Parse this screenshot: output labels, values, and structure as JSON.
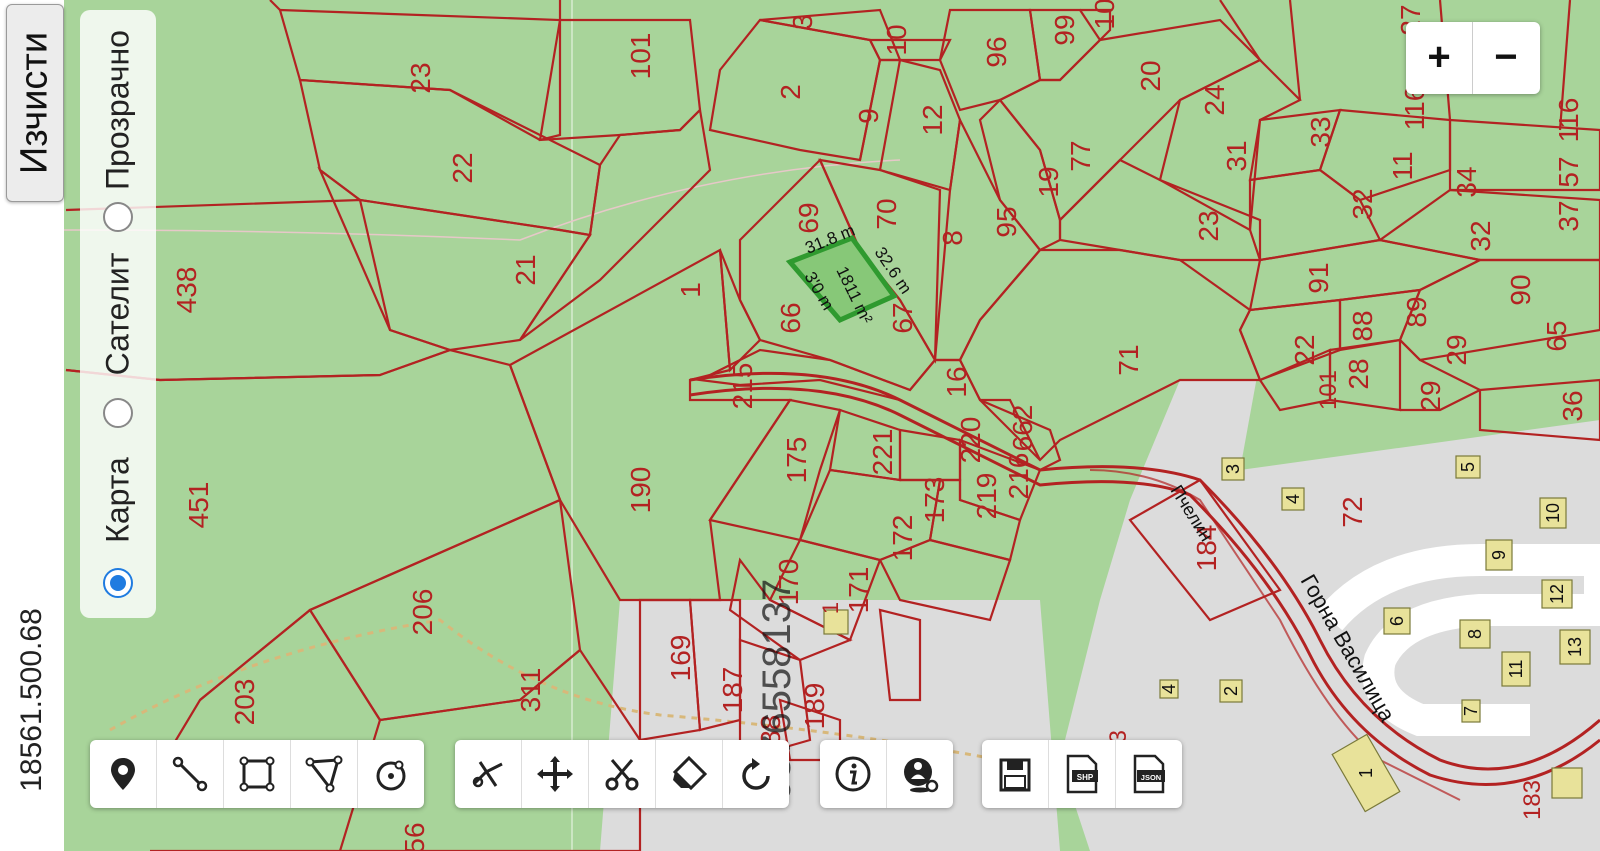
{
  "map": {
    "colors": {
      "forest": "#a8d49a",
      "urban": "#dcdcdc",
      "parcel_line": "#b32222",
      "selected": "#2f9a2f"
    },
    "parcels_left": [
      {
        "id": "p-23",
        "label": "23"
      },
      {
        "id": "p-22",
        "label": "22"
      },
      {
        "id": "p-21",
        "label": "21"
      },
      {
        "id": "p-438",
        "label": "438"
      },
      {
        "id": "p-451",
        "label": "451"
      },
      {
        "id": "p-206",
        "label": "206"
      },
      {
        "id": "p-203",
        "label": "203"
      },
      {
        "id": "p-311",
        "label": "311"
      },
      {
        "id": "p-101",
        "label": "101"
      },
      {
        "id": "p-190",
        "label": "190"
      },
      {
        "id": "p-1",
        "label": "1"
      },
      {
        "id": "p-56",
        "label": "56"
      }
    ],
    "parcels_center": [
      {
        "id": "p-2",
        "label": "2"
      },
      {
        "id": "p-3",
        "label": "3"
      },
      {
        "id": "p-10",
        "label": "10"
      },
      {
        "id": "p-9",
        "label": "9"
      },
      {
        "id": "p-12",
        "label": "12"
      },
      {
        "id": "p-69",
        "label": "69"
      },
      {
        "id": "p-70",
        "label": "70"
      },
      {
        "id": "p-8",
        "label": "8"
      },
      {
        "id": "p-66",
        "label": "66"
      },
      {
        "id": "p-67",
        "label": "67"
      },
      {
        "id": "p-215",
        "label": "215"
      },
      {
        "id": "p-16",
        "label": "16"
      },
      {
        "id": "p-175",
        "label": "175"
      },
      {
        "id": "p-221",
        "label": "221"
      },
      {
        "id": "p-220",
        "label": "220"
      },
      {
        "id": "p-173",
        "label": "173"
      },
      {
        "id": "p-219",
        "label": "219"
      },
      {
        "id": "p-172",
        "label": "172"
      },
      {
        "id": "p-171",
        "label": "171"
      },
      {
        "id": "p-170",
        "label": "170"
      },
      {
        "id": "p-169",
        "label": "169"
      },
      {
        "id": "p-187",
        "label": "187"
      },
      {
        "id": "p-188",
        "label": "188"
      },
      {
        "id": "p-189",
        "label": "189"
      },
      {
        "id": "p-662",
        "label": "662"
      },
      {
        "id": "p-216",
        "label": "216"
      },
      {
        "id": "p-1b",
        "label": "1"
      }
    ],
    "parcels_right": [
      {
        "id": "p-96",
        "label": "96"
      },
      {
        "id": "p-99",
        "label": "99"
      },
      {
        "id": "p-100",
        "label": "10"
      },
      {
        "id": "p-20",
        "label": "20"
      },
      {
        "id": "p-27",
        "label": "27"
      },
      {
        "id": "p-24",
        "label": "24"
      },
      {
        "id": "p-33",
        "label": "33"
      },
      {
        "id": "p-31",
        "label": "31"
      },
      {
        "id": "p-116",
        "label": "116"
      },
      {
        "id": "p-116b",
        "label": "116"
      },
      {
        "id": "p-11",
        "label": "11"
      },
      {
        "id": "p-32",
        "label": "32"
      },
      {
        "id": "p-34",
        "label": "34"
      },
      {
        "id": "p-57",
        "label": "57"
      },
      {
        "id": "p-37",
        "label": "37"
      },
      {
        "id": "p-77",
        "label": "77"
      },
      {
        "id": "p-19",
        "label": "19"
      },
      {
        "id": "p-95",
        "label": "95"
      },
      {
        "id": "p-23b",
        "label": "23"
      },
      {
        "id": "p-91",
        "label": "91"
      },
      {
        "id": "p-89",
        "label": "89"
      },
      {
        "id": "p-88",
        "label": "88"
      },
      {
        "id": "p-90",
        "label": "90"
      },
      {
        "id": "p-32b",
        "label": "32"
      },
      {
        "id": "p-65",
        "label": "65"
      },
      {
        "id": "p-71",
        "label": "71"
      },
      {
        "id": "p-22b",
        "label": "22"
      },
      {
        "id": "p-28",
        "label": "28"
      },
      {
        "id": "p-29",
        "label": "29"
      },
      {
        "id": "p-29b",
        "label": "29"
      },
      {
        "id": "p-36",
        "label": "36"
      },
      {
        "id": "p-101b",
        "label": "101"
      },
      {
        "id": "p-72",
        "label": "72"
      },
      {
        "id": "p-184",
        "label": "184"
      },
      {
        "id": "p-183",
        "label": "183"
      },
      {
        "id": "p-133",
        "label": "133"
      }
    ],
    "buildings": [
      {
        "id": "b-3",
        "label": "3"
      },
      {
        "id": "b-5",
        "label": "5"
      },
      {
        "id": "b-4",
        "label": "4"
      },
      {
        "id": "b-10",
        "label": "10"
      },
      {
        "id": "b-9",
        "label": "9"
      },
      {
        "id": "b-12",
        "label": "12"
      },
      {
        "id": "b-8",
        "label": "8"
      },
      {
        "id": "b-11",
        "label": "11"
      },
      {
        "id": "b-13",
        "label": "13"
      },
      {
        "id": "b-2",
        "label": "2"
      },
      {
        "id": "b-7",
        "label": "7"
      },
      {
        "id": "b-1",
        "label": "1"
      },
      {
        "id": "b-6",
        "label": "6"
      },
      {
        "id": "b-4b",
        "label": "4"
      }
    ],
    "street_label": "Горна Василица",
    "street_label_2": "Пчелин",
    "measurements": {
      "top": "31.8 m",
      "right": "32.6 m",
      "left": "3'0 m",
      "area": "1811 m²"
    },
    "watermark": "0876558137"
  },
  "sidebar": {
    "clear_label": "Изчисти",
    "coordinates": "18561.500.68"
  },
  "layers": {
    "options": [
      {
        "label": "Карта",
        "selected": true
      },
      {
        "label": "Сателит",
        "selected": false
      },
      {
        "label": "Прозрачно",
        "selected": false
      }
    ]
  },
  "zoom": {
    "in_label": "+",
    "out_label": "−"
  },
  "toolbar": {
    "draw_tools": [
      "marker-icon",
      "polyline-icon",
      "rectangle-icon",
      "polygon-icon",
      "circle-icon"
    ],
    "edit_tools": [
      "draw-cut-icon",
      "move-icon",
      "scissors-icon",
      "eraser-icon",
      "rotate-icon"
    ],
    "info_tools": [
      "info-icon",
      "locate-person-icon"
    ],
    "export_tools": [
      {
        "icon": "save-icon",
        "badge": ""
      },
      {
        "icon": "shp-file-icon",
        "badge": "SHP"
      },
      {
        "icon": "json-file-icon",
        "badge": "JSON"
      }
    ]
  }
}
